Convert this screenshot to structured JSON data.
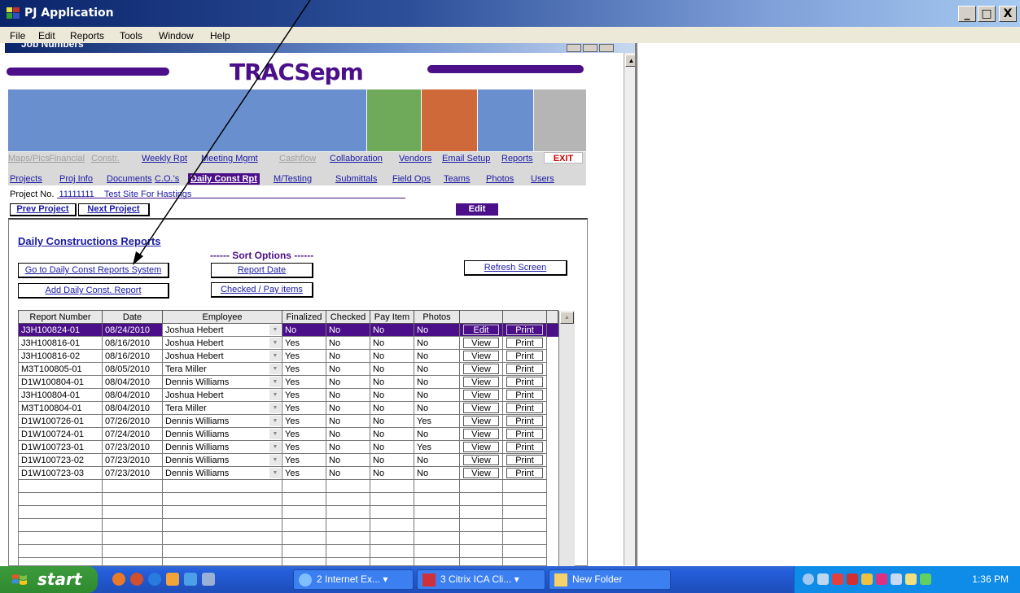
{
  "window": {
    "title": "PJ Application",
    "buttons": {
      "minimize": "_",
      "maximize": "□",
      "close": "X"
    }
  },
  "menu": [
    "File",
    "Edit",
    "Reports",
    "Tools",
    "Window",
    "Help"
  ],
  "inner_window": {
    "title": "Job Numbers"
  },
  "brand": "TRACSepm",
  "colors": {
    "brand": "#4b0f89",
    "band_blue": "#6a8fce",
    "band_green": "#6fa95a",
    "band_orange": "#d0693a",
    "band_gray": "#b5b5b5",
    "link": "#1a1aa6"
  },
  "nav_row1": [
    {
      "label": "Maps/Pics",
      "enabled": false
    },
    {
      "label": "Financial",
      "enabled": false
    },
    {
      "label": "Constr.",
      "enabled": false
    },
    {
      "label": "Weekly Rpt",
      "enabled": true
    },
    {
      "label": "Meeting Mgmt",
      "enabled": true
    },
    {
      "label": "Cashflow",
      "enabled": false
    },
    {
      "label": "Collaboration",
      "enabled": true
    },
    {
      "label": "Vendors",
      "enabled": true
    },
    {
      "label": "Email Setup",
      "enabled": true
    },
    {
      "label": "Reports",
      "enabled": true
    }
  ],
  "exit_label": "EXIT",
  "nav_row2": [
    {
      "label": "Projects"
    },
    {
      "label": "Proj Info"
    },
    {
      "label": "Documents"
    },
    {
      "label": "C.O.'s"
    },
    {
      "label": "Daily Const Rpt",
      "active": true
    },
    {
      "label": "M/Testing"
    },
    {
      "label": "Submittals"
    },
    {
      "label": "Field Ops"
    },
    {
      "label": "Teams"
    },
    {
      "label": "Photos"
    },
    {
      "label": "Users"
    }
  ],
  "project": {
    "label": "Project No.",
    "number": "11111111",
    "name": "Test Site For Hastings"
  },
  "prev_project": "Prev Project",
  "next_project": "Next Project",
  "edit_label": "Edit",
  "section_title": "Daily Constructions Reports",
  "sort_title": "------ Sort Options ------",
  "buttons": {
    "go_to_system": "Go to Daily Const Reports System",
    "add_report": "Add Daily Const. Report",
    "report_date": "Report Date",
    "checked_pay": "Checked / Pay items",
    "refresh": "Refresh Screen"
  },
  "table": {
    "headers": [
      "Report Number",
      "Date",
      "Employee",
      "Finalized",
      "Checked",
      "Pay Item",
      "Photos",
      "",
      ""
    ],
    "rows": [
      {
        "report": "J3H100824-01",
        "date": "08/24/2010",
        "employee": "Joshua Hebert",
        "finalized": "No",
        "checked": "No",
        "pay": "No",
        "photos": "No",
        "action": "Edit",
        "print": "Print",
        "selected": true
      },
      {
        "report": "J3H100816-01",
        "date": "08/16/2010",
        "employee": "Joshua Hebert",
        "finalized": "Yes",
        "checked": "No",
        "pay": "No",
        "photos": "No",
        "action": "View",
        "print": "Print"
      },
      {
        "report": "J3H100816-02",
        "date": "08/16/2010",
        "employee": "Joshua Hebert",
        "finalized": "Yes",
        "checked": "No",
        "pay": "No",
        "photos": "No",
        "action": "View",
        "print": "Print"
      },
      {
        "report": "M3T100805-01",
        "date": "08/05/2010",
        "employee": "Tera Miller",
        "finalized": "Yes",
        "checked": "No",
        "pay": "No",
        "photos": "No",
        "action": "View",
        "print": "Print"
      },
      {
        "report": "D1W100804-01",
        "date": "08/04/2010",
        "employee": "Dennis Williams",
        "finalized": "Yes",
        "checked": "No",
        "pay": "No",
        "photos": "No",
        "action": "View",
        "print": "Print"
      },
      {
        "report": "J3H100804-01",
        "date": "08/04/2010",
        "employee": "Joshua Hebert",
        "finalized": "Yes",
        "checked": "No",
        "pay": "No",
        "photos": "No",
        "action": "View",
        "print": "Print"
      },
      {
        "report": "M3T100804-01",
        "date": "08/04/2010",
        "employee": "Tera Miller",
        "finalized": "Yes",
        "checked": "No",
        "pay": "No",
        "photos": "No",
        "action": "View",
        "print": "Print"
      },
      {
        "report": "D1W100726-01",
        "date": "07/26/2010",
        "employee": "Dennis Williams",
        "finalized": "Yes",
        "checked": "No",
        "pay": "No",
        "photos": "Yes",
        "action": "View",
        "print": "Print"
      },
      {
        "report": "D1W100724-01",
        "date": "07/24/2010",
        "employee": "Dennis Williams",
        "finalized": "Yes",
        "checked": "No",
        "pay": "No",
        "photos": "No",
        "action": "View",
        "print": "Print"
      },
      {
        "report": "D1W100723-01",
        "date": "07/23/2010",
        "employee": "Dennis Williams",
        "finalized": "Yes",
        "checked": "No",
        "pay": "No",
        "photos": "Yes",
        "action": "View",
        "print": "Print"
      },
      {
        "report": "D1W100723-02",
        "date": "07/23/2010",
        "employee": "Dennis Williams",
        "finalized": "Yes",
        "checked": "No",
        "pay": "No",
        "photos": "No",
        "action": "View",
        "print": "Print"
      },
      {
        "report": "D1W100723-03",
        "date": "07/23/2010",
        "employee": "Dennis Williams",
        "finalized": "Yes",
        "checked": "No",
        "pay": "No",
        "photos": "No",
        "action": "View",
        "print": "Print"
      }
    ],
    "empty_rows": 7
  },
  "taskbar": {
    "start": "start",
    "items": [
      {
        "label": "2 Internet Ex...",
        "icon": "internet-explorer-icon"
      },
      {
        "label": "3 Citrix ICA Cli...",
        "icon": "citrix-icon"
      },
      {
        "label": "New Folder",
        "icon": "folder-icon"
      }
    ],
    "clock": "1:36 PM"
  }
}
